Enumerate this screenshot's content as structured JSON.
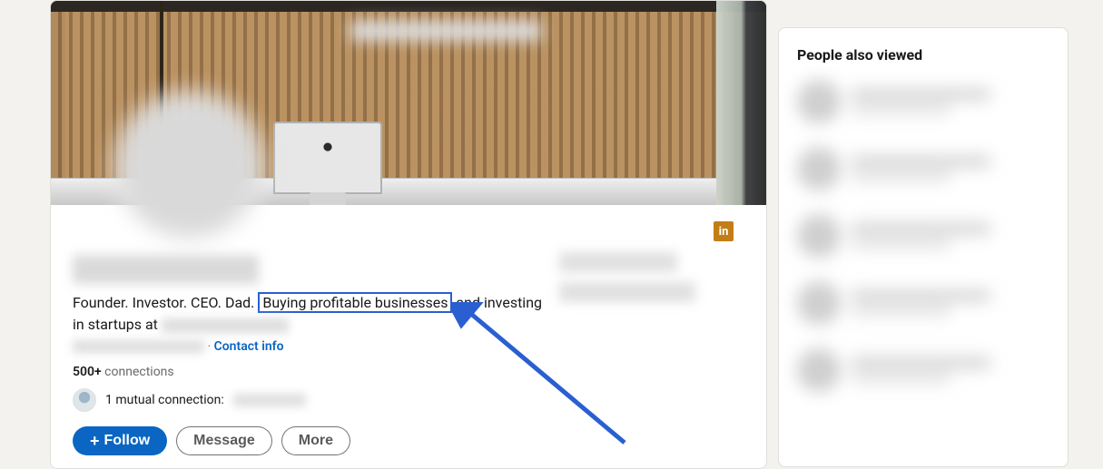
{
  "profile": {
    "headline_before": "Founder. Investor. CEO. Dad. ",
    "headline_highlight": "Buying profitable businesses",
    "headline_after": " and investing in startups at ",
    "contact_sep": " · ",
    "contact_info_label": "Contact info",
    "connections_count": "500+",
    "connections_label": " connections",
    "mutual_label": "1 mutual connection:",
    "linkedin_badge": "in"
  },
  "actions": {
    "follow_plus": "+",
    "follow_label": "Follow",
    "message_label": "Message",
    "more_label": "More"
  },
  "side": {
    "title": "People also viewed"
  }
}
